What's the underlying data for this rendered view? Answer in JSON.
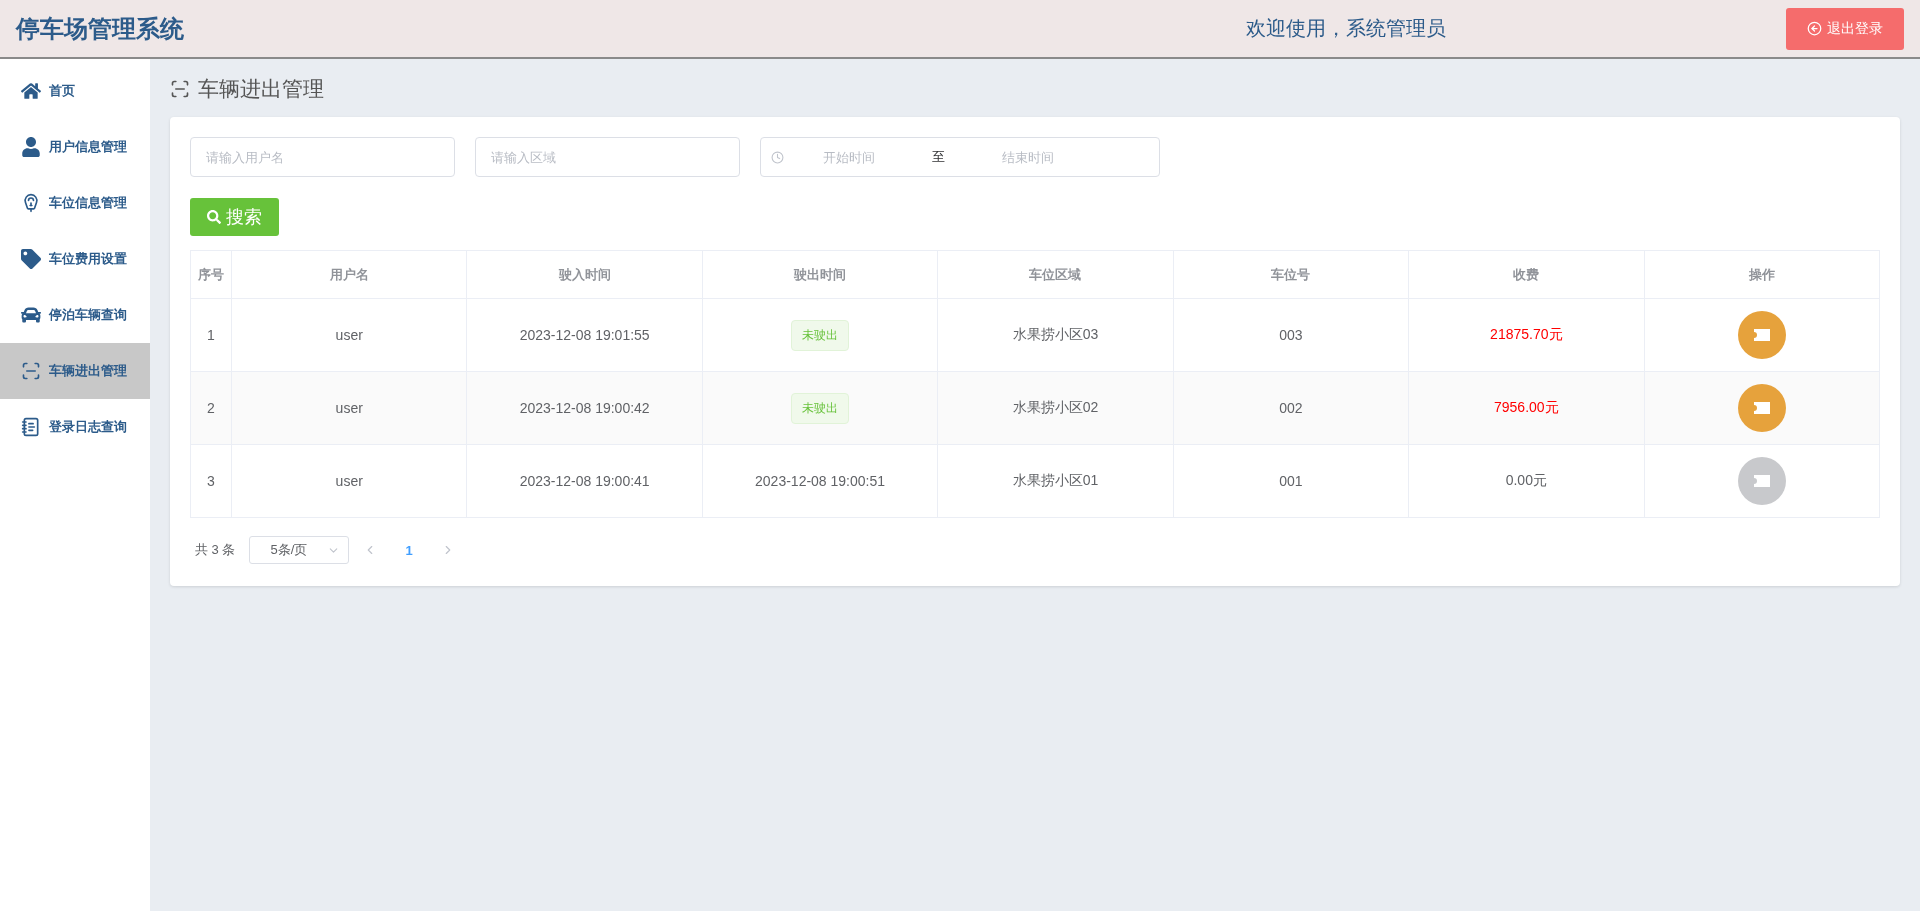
{
  "header": {
    "title": "停车场管理系统",
    "welcome": "欢迎使用，系统管理员",
    "logout": "退出登录"
  },
  "sidebar": {
    "items": [
      {
        "kind": "home",
        "label": "首页",
        "selected": false
      },
      {
        "kind": "user",
        "label": "用户信息管理",
        "selected": false
      },
      {
        "kind": "parking",
        "label": "车位信息管理",
        "selected": false
      },
      {
        "kind": "tag",
        "label": "车位费用设置",
        "selected": false
      },
      {
        "kind": "car",
        "label": "停泊车辆查询",
        "selected": false
      },
      {
        "kind": "scan",
        "label": "车辆进出管理",
        "selected": true
      },
      {
        "kind": "log",
        "label": "登录日志查询",
        "selected": false
      }
    ]
  },
  "page_title": "车辆进出管理",
  "filters": {
    "username": {
      "placeholder": "请输入用户名"
    },
    "area": {
      "placeholder": "请输入区域"
    },
    "date_range": {
      "start_placeholder": "开始时间",
      "separator": "至",
      "end_placeholder": "结束时间"
    },
    "search_button": "搜索"
  },
  "table": {
    "columns": [
      "序号",
      "用户名",
      "驶入时间",
      "驶出时间",
      "车位区域",
      "车位号",
      "收费",
      "操作"
    ],
    "rows": [
      {
        "index": "1",
        "username": "user",
        "entry_time": "2023-12-08 19:01:55",
        "exit_time": {
          "kind": "tag",
          "text": "未驶出"
        },
        "area": "水果捞小区03",
        "spot": "003",
        "fee": "21875.70元",
        "fee_due": true,
        "pay_disabled": false
      },
      {
        "index": "2",
        "username": "user",
        "entry_time": "2023-12-08 19:00:42",
        "exit_time": {
          "kind": "tag",
          "text": "未驶出"
        },
        "area": "水果捞小区02",
        "spot": "002",
        "fee": "7956.00元",
        "fee_due": true,
        "pay_disabled": false
      },
      {
        "index": "3",
        "username": "user",
        "entry_time": "2023-12-08 19:00:41",
        "exit_time": {
          "kind": "text",
          "text": "2023-12-08 19:00:51"
        },
        "area": "水果捞小区01",
        "spot": "001",
        "fee": "0.00元",
        "fee_due": false,
        "pay_disabled": true
      }
    ]
  },
  "pagination": {
    "total": "共 3 条",
    "page_size": "5条/页",
    "pages": [
      {
        "label": "1",
        "selected": true
      }
    ]
  }
}
